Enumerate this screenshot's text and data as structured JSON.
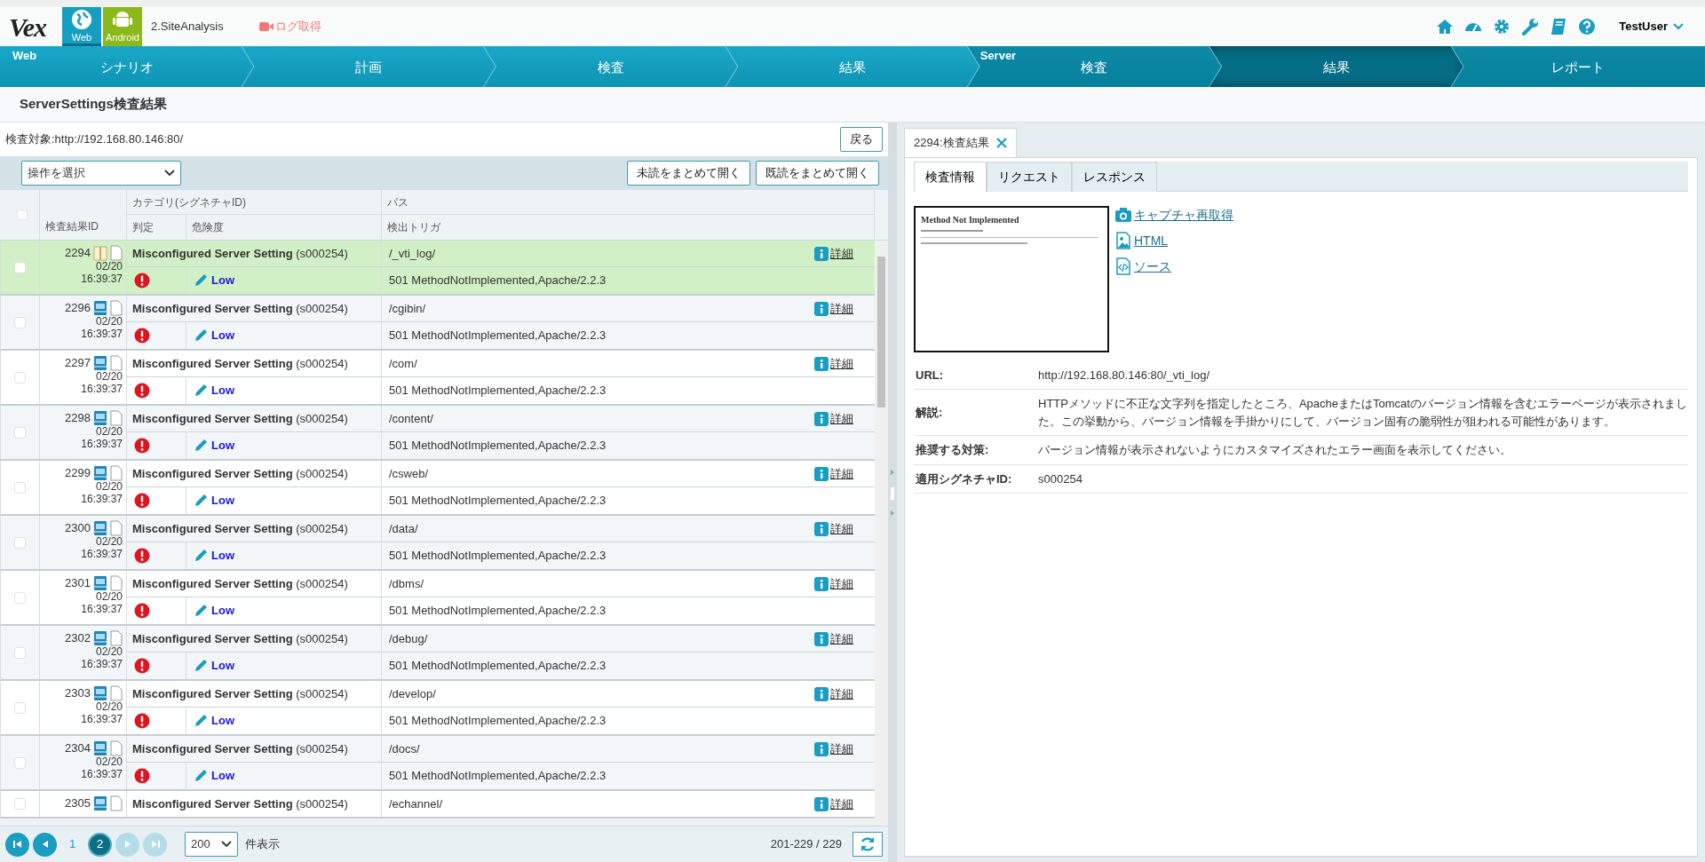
{
  "header": {
    "logo": "Vex",
    "platform_tabs": [
      {
        "kind": "web",
        "label": "Web",
        "selected": true
      },
      {
        "kind": "android",
        "label": "Android",
        "selected": false
      }
    ],
    "project": "2.SiteAnalysis",
    "log_button": "ログ取得",
    "user": "TestUser"
  },
  "step_groups": [
    {
      "label": "Web",
      "steps": [
        {
          "label": "シナリオ",
          "selected": false
        },
        {
          "label": "計画",
          "selected": false
        },
        {
          "label": "検査",
          "selected": false
        },
        {
          "label": "結果",
          "selected": false
        }
      ]
    },
    {
      "label": "Server",
      "steps": [
        {
          "label": "検査",
          "selected": false
        },
        {
          "label": "結果",
          "selected": true
        },
        {
          "label": "レポート",
          "selected": false
        }
      ]
    }
  ],
  "page_title": "ServerSettings検査結果",
  "target": "検査対象:http://192.168.80.146:80/",
  "back_button": "戻る",
  "action_select": "操作を選択",
  "bulk_buttons": [
    "未読をまとめて開く",
    "既読をまとめて開く"
  ],
  "table": {
    "header_checked": false,
    "columns": {
      "id": "検査結果ID",
      "category": "カテゴリ(シグネチャID)",
      "path": "パス",
      "judgement": "判定",
      "severity": "危険度",
      "trigger": "検出トリガ"
    },
    "rows": [
      {
        "id": "2294",
        "date": "02/20",
        "time": "16:39:37",
        "category": "Misconfigured Server Setting",
        "signature": "(s000254)",
        "path": "/_vti_log/",
        "detail_link": "詳細",
        "severity": "Low",
        "trigger": "501 MethodNotImplemented,Apache/2.2.3",
        "selected": true,
        "read": true,
        "checked": false
      },
      {
        "id": "2296",
        "date": "02/20",
        "time": "16:39:37",
        "category": "Misconfigured Server Setting",
        "signature": "(s000254)",
        "path": "/cgibin/",
        "detail_link": "詳細",
        "severity": "Low",
        "trigger": "501 MethodNotImplemented,Apache/2.2.3",
        "selected": false,
        "read": false,
        "checked": false
      },
      {
        "id": "2297",
        "date": "02/20",
        "time": "16:39:37",
        "category": "Misconfigured Server Setting",
        "signature": "(s000254)",
        "path": "/com/",
        "detail_link": "詳細",
        "severity": "Low",
        "trigger": "501 MethodNotImplemented,Apache/2.2.3",
        "selected": false,
        "read": false,
        "checked": false
      },
      {
        "id": "2298",
        "date": "02/20",
        "time": "16:39:37",
        "category": "Misconfigured Server Setting",
        "signature": "(s000254)",
        "path": "/content/",
        "detail_link": "詳細",
        "severity": "Low",
        "trigger": "501 MethodNotImplemented,Apache/2.2.3",
        "selected": false,
        "read": false,
        "checked": false
      },
      {
        "id": "2299",
        "date": "02/20",
        "time": "16:39:37",
        "category": "Misconfigured Server Setting",
        "signature": "(s000254)",
        "path": "/csweb/",
        "detail_link": "詳細",
        "severity": "Low",
        "trigger": "501 MethodNotImplemented,Apache/2.2.3",
        "selected": false,
        "read": false,
        "checked": false
      },
      {
        "id": "2300",
        "date": "02/20",
        "time": "16:39:37",
        "category": "Misconfigured Server Setting",
        "signature": "(s000254)",
        "path": "/data/",
        "detail_link": "詳細",
        "severity": "Low",
        "trigger": "501 MethodNotImplemented,Apache/2.2.3",
        "selected": false,
        "read": false,
        "checked": false
      },
      {
        "id": "2301",
        "date": "02/20",
        "time": "16:39:37",
        "category": "Misconfigured Server Setting",
        "signature": "(s000254)",
        "path": "/dbms/",
        "detail_link": "詳細",
        "severity": "Low",
        "trigger": "501 MethodNotImplemented,Apache/2.2.3",
        "selected": false,
        "read": false,
        "checked": false
      },
      {
        "id": "2302",
        "date": "02/20",
        "time": "16:39:37",
        "category": "Misconfigured Server Setting",
        "signature": "(s000254)",
        "path": "/debug/",
        "detail_link": "詳細",
        "severity": "Low",
        "trigger": "501 MethodNotImplemented,Apache/2.2.3",
        "selected": false,
        "read": false,
        "checked": false
      },
      {
        "id": "2303",
        "date": "02/20",
        "time": "16:39:37",
        "category": "Misconfigured Server Setting",
        "signature": "(s000254)",
        "path": "/develop/",
        "detail_link": "詳細",
        "severity": "Low",
        "trigger": "501 MethodNotImplemented,Apache/2.2.3",
        "selected": false,
        "read": false,
        "checked": false
      },
      {
        "id": "2304",
        "date": "02/20",
        "time": "16:39:37",
        "category": "Misconfigured Server Setting",
        "signature": "(s000254)",
        "path": "/docs/",
        "detail_link": "詳細",
        "severity": "Low",
        "trigger": "501 MethodNotImplemented,Apache/2.2.3",
        "selected": false,
        "read": false,
        "checked": false
      },
      {
        "id": "2305",
        "category": "Misconfigured Server Setting",
        "signature": "(s000254)",
        "path": "/echannel/",
        "detail_link": "詳細",
        "selected": false,
        "read": false,
        "checked": false
      }
    ]
  },
  "pager": {
    "first_disabled": false,
    "prev_disabled": false,
    "next_disabled": true,
    "last_disabled": true,
    "pages": [
      {
        "label": "1",
        "selected": false
      },
      {
        "label": "2",
        "selected": true
      }
    ],
    "page_size": "200",
    "page_size_suffix": "件表示",
    "range": "201-229 / 229"
  },
  "detail": {
    "tab_label": "2294:検査結果",
    "sub_tabs": [
      {
        "label": "検査情報",
        "selected": true
      },
      {
        "label": "リクエスト",
        "selected": false
      },
      {
        "label": "レスポンス",
        "selected": false
      }
    ],
    "preview_title": "Method Not Implemented",
    "links": [
      {
        "kind": "camera",
        "label": "キャプチャ再取得"
      },
      {
        "kind": "image",
        "label": "HTML"
      },
      {
        "kind": "code",
        "label": "ソース"
      }
    ],
    "info": [
      {
        "label": "URL:",
        "value": "http://192.168.80.146:80/_vti_log/"
      },
      {
        "label": "解説:",
        "value": "HTTPメソッドに不正な文字列を指定したところ、ApacheまたはTomcatのバージョン情報を含むエラーページが表示されました。この挙動から、バージョン情報を手掛かりにして、バージョン固有の脆弱性が狙われる可能性があります。"
      },
      {
        "label": "推奨する対策:",
        "value": "バージョン情報が表示されないようにカスタマイズされたエラー画面を表示してください。"
      },
      {
        "label": "適用シグネチャID:",
        "value": "s000254"
      }
    ]
  }
}
